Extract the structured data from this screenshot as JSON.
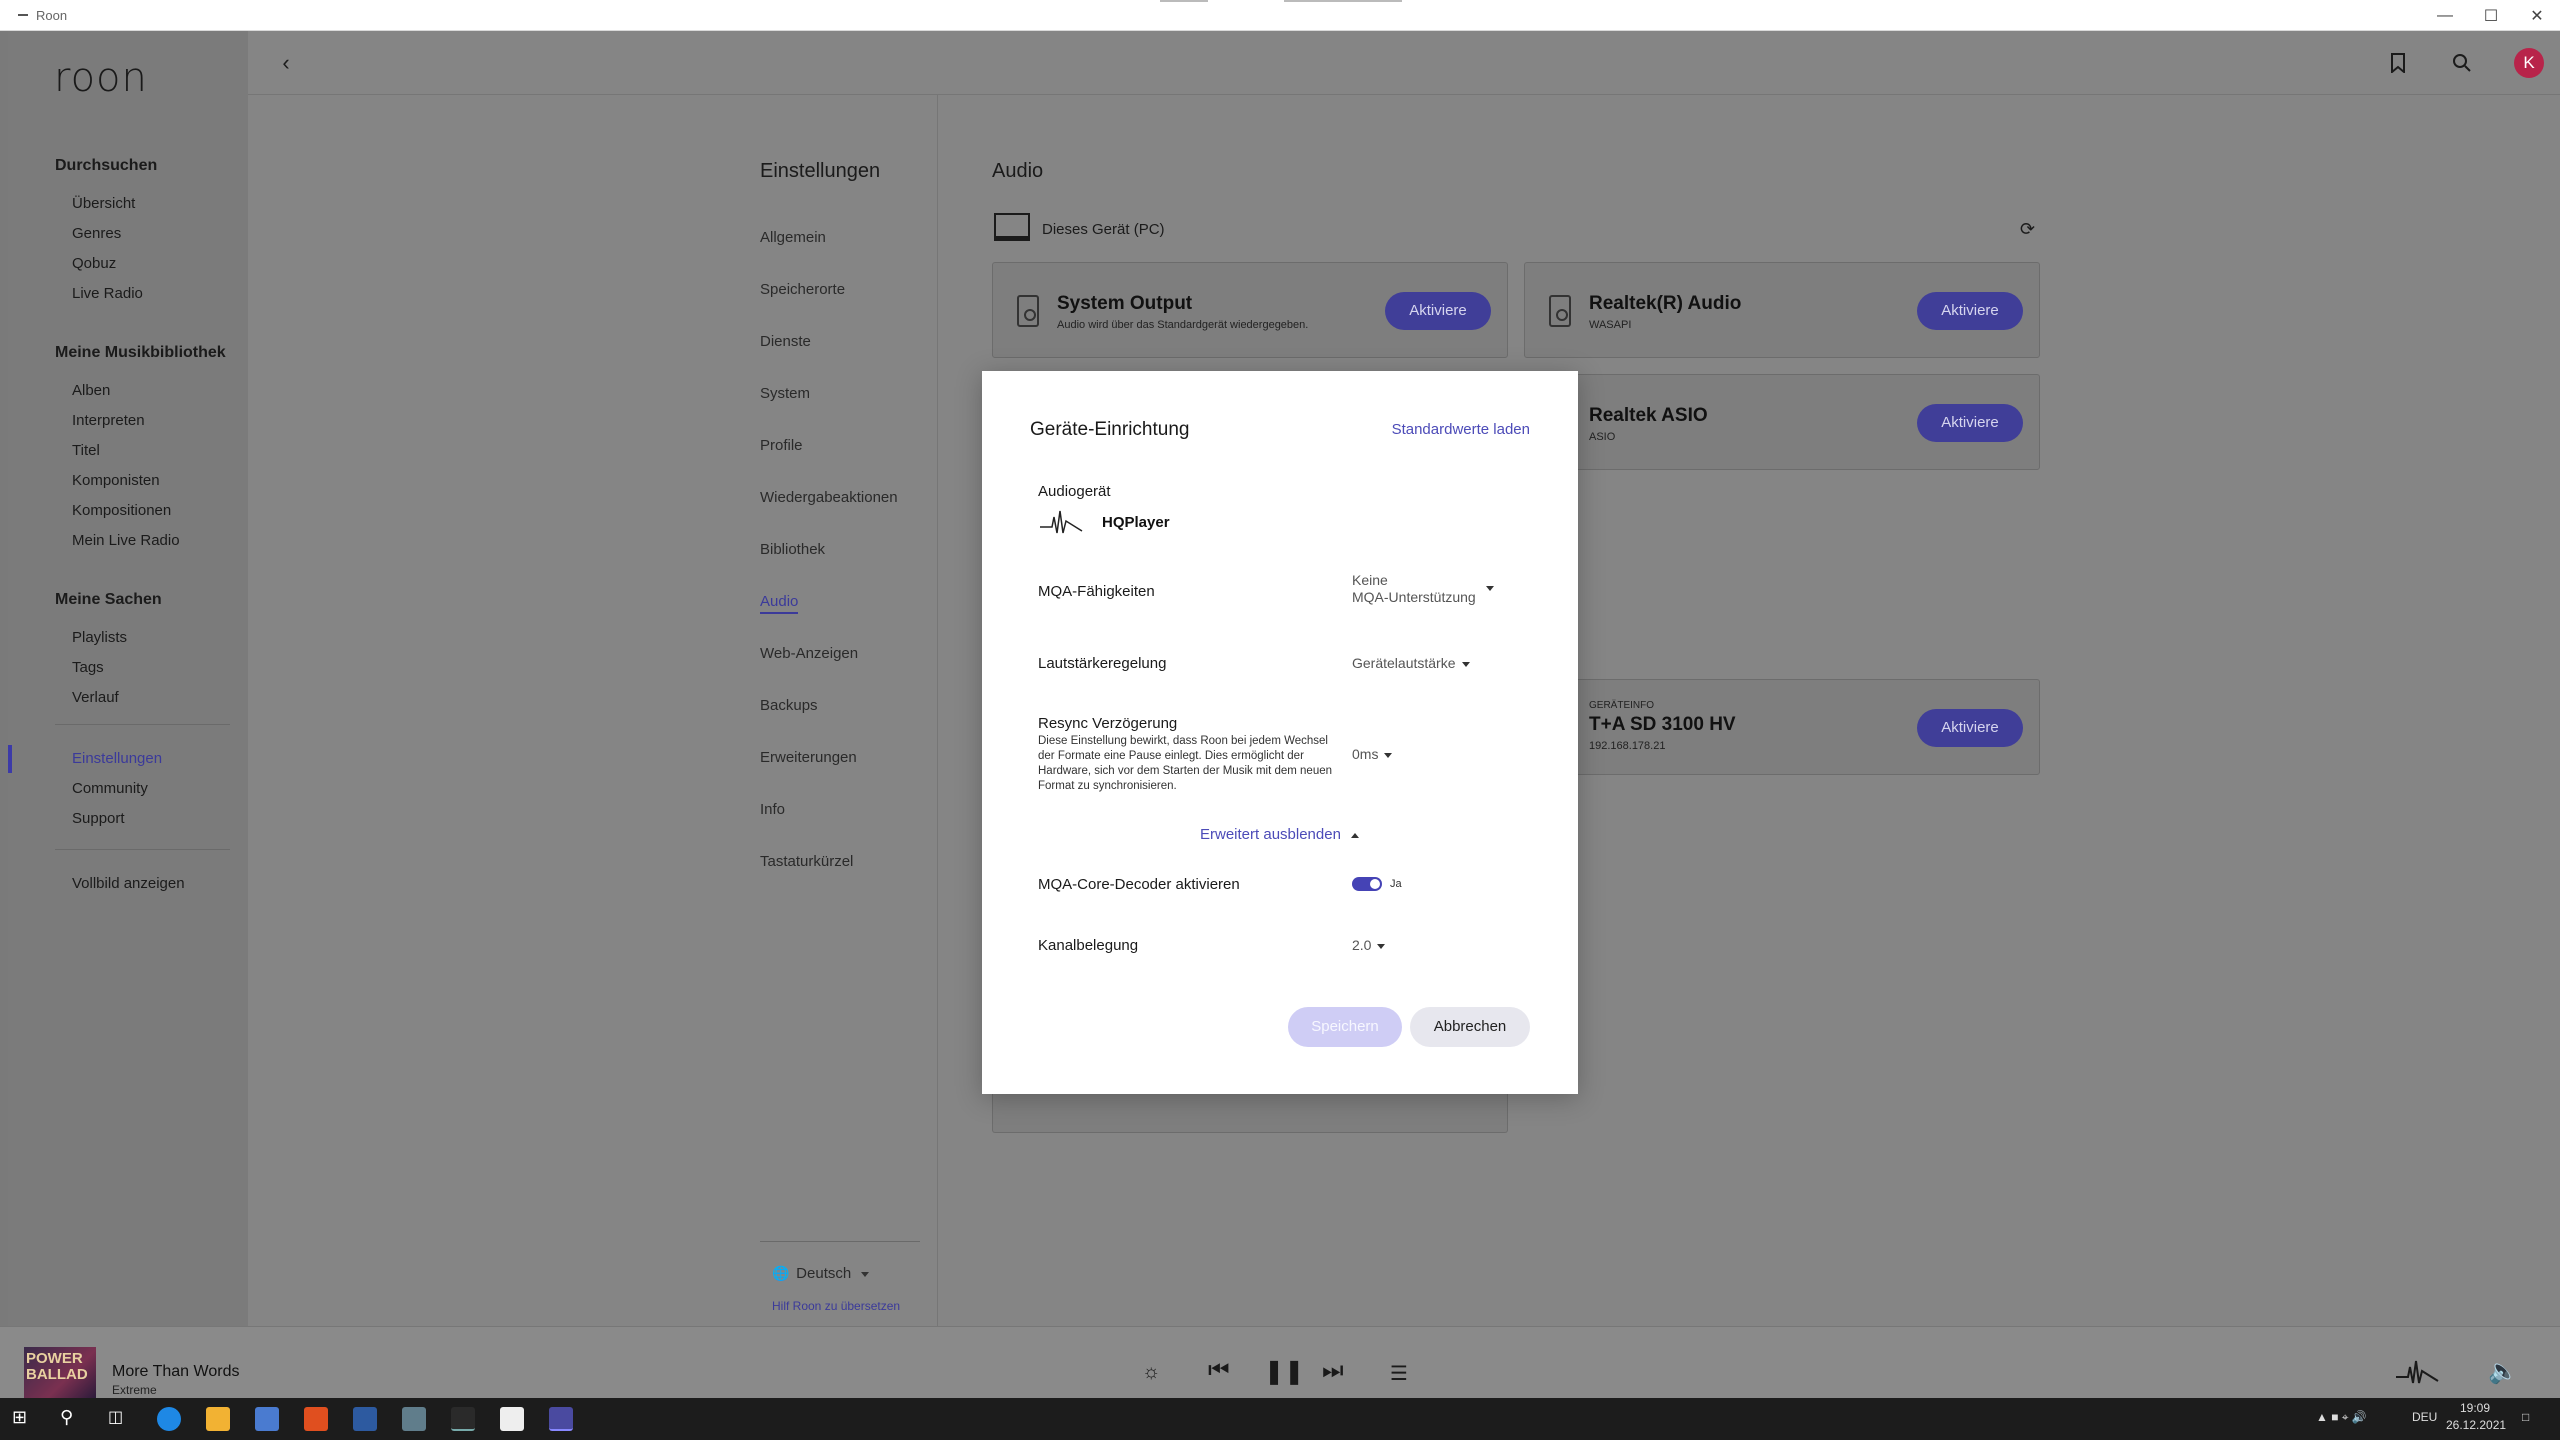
{
  "window": {
    "title": "Roon"
  },
  "app": {
    "logo": "roon"
  },
  "sidebar": {
    "browse_header": "Durchsuchen",
    "browse_items": [
      "Übersicht",
      "Genres",
      "Qobuz",
      "Live Radio"
    ],
    "library_header": "Meine Musikbibliothek",
    "library_items": [
      "Alben",
      "Interpreten",
      "Titel",
      "Komponisten",
      "Kompositionen",
      "Mein Live Radio"
    ],
    "stuff_header": "Meine Sachen",
    "stuff_items": [
      "Playlists",
      "Tags",
      "Verlauf"
    ],
    "bottom_items": [
      "Einstellungen",
      "Community",
      "Support"
    ],
    "fullscreen": "Vollbild anzeigen"
  },
  "topbar": {
    "avatar_initial": "K"
  },
  "settings": {
    "title": "Einstellungen",
    "items": [
      "Allgemein",
      "Speicherorte",
      "Dienste",
      "System",
      "Profile",
      "Wiedergabeaktionen",
      "Bibliothek",
      "Audio",
      "Web-Anzeigen",
      "Backups",
      "Erweiterungen",
      "Info",
      "Tastaturkürzel"
    ],
    "language": "Deutsch",
    "help_translate": "Hilf Roon zu übersetzen"
  },
  "audio": {
    "title": "Audio",
    "device_group": "Dieses Gerät (PC)",
    "cards": [
      {
        "name": "System Output",
        "sub": "Audio wird über das Standardgerät wiedergegeben.",
        "button": "Aktiviere"
      },
      {
        "name": "Realtek(R) Audio",
        "sub": "WASAPI",
        "button": "Aktiviere"
      },
      {
        "name": "Realtek ASIO",
        "sub": "ASIO",
        "button": "Aktiviere"
      },
      {
        "overline": "GERÄTEINFO",
        "name": "T+A SD 3100 HV",
        "sub": "192.168.178.21",
        "button": "Aktiviere"
      }
    ]
  },
  "modal": {
    "title": "Geräte-Einrichtung",
    "load_defaults": "Standardwerte laden",
    "audio_device_label": "Audiogerät",
    "audio_device_name": "HQPlayer",
    "mqa_label": "MQA-Fähigkeiten",
    "mqa_value_1": "Keine",
    "mqa_value_2": "MQA-Unterstützung",
    "volume_label": "Lautstärkeregelung",
    "volume_value": "Gerätelautstärke",
    "resync_label": "Resync Verzögerung",
    "resync_desc": "Diese Einstellung bewirkt, dass Roon bei jedem Wechsel der Formate eine Pause einlegt. Dies ermöglicht der Hardware, sich vor dem Starten der Musik mit dem neuen Format zu synchronisieren.",
    "resync_value": "0ms",
    "advanced_toggle": "Erweitert ausblenden",
    "mqa_core_label": "MQA-Core-Decoder aktivieren",
    "mqa_core_value": "Ja",
    "channel_label": "Kanalbelegung",
    "channel_value": "2.0",
    "save": "Speichern",
    "cancel": "Abbrechen"
  },
  "player": {
    "album_art_text": "POWER BALLAD",
    "track": "More Than Words",
    "artist": "Extreme"
  },
  "taskbar": {
    "lang": "DEU",
    "time": "19:09",
    "date": "26.12.2021"
  },
  "colors": {
    "accent": "#4543b5",
    "button_dark": "#403e98"
  }
}
